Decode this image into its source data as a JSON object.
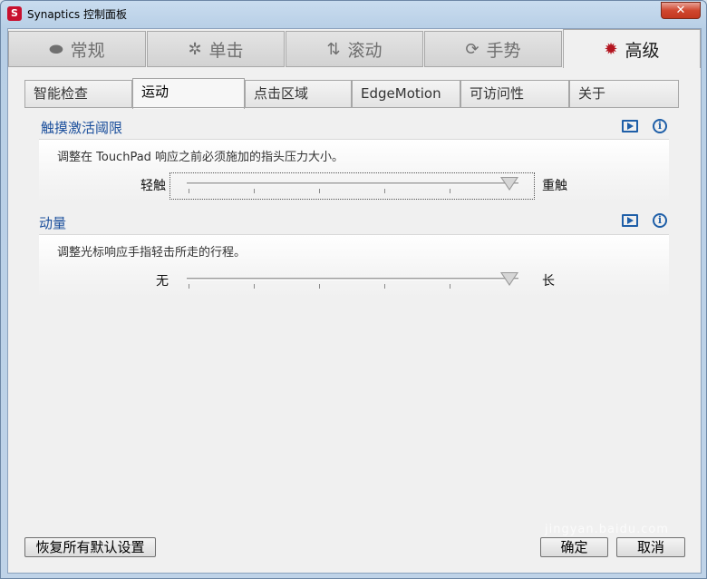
{
  "window": {
    "title": "Synaptics 控制面板",
    "close_label": "✕"
  },
  "main_tabs": [
    {
      "label": "常规",
      "icon": "general-icon",
      "glyph": "⬬"
    },
    {
      "label": "单击",
      "icon": "click-icon",
      "glyph": "✲"
    },
    {
      "label": "滚动",
      "icon": "scroll-icon",
      "glyph": "⇅"
    },
    {
      "label": "手势",
      "icon": "gesture-icon",
      "glyph": "⟳"
    },
    {
      "label": "高级",
      "icon": "gear-icon",
      "glyph": "✹"
    }
  ],
  "active_main_tab": "高级",
  "sub_tabs": [
    "智能检查",
    "运动",
    "点击区域",
    "EdgeMotion",
    "可访问性",
    "关于"
  ],
  "active_sub_tab": "运动",
  "sections": [
    {
      "title": "触摸激活阈限",
      "description": "调整在 TouchPad 响应之前必须施加的指头压力大小。",
      "min_label": "轻触",
      "max_label": "重触",
      "value": 1.0
    },
    {
      "title": "动量",
      "description": "调整光标响应手指轻击所走的行程。",
      "min_label": "无",
      "max_label": "长",
      "value": 1.0
    }
  ],
  "buttons": {
    "restore_defaults": "恢复所有默认设置",
    "ok": "确定",
    "cancel": "取消"
  },
  "watermark": "jingyan.baidu.com",
  "colors": {
    "accent": "#1b4f9c",
    "active_icon": "#b3141f"
  }
}
